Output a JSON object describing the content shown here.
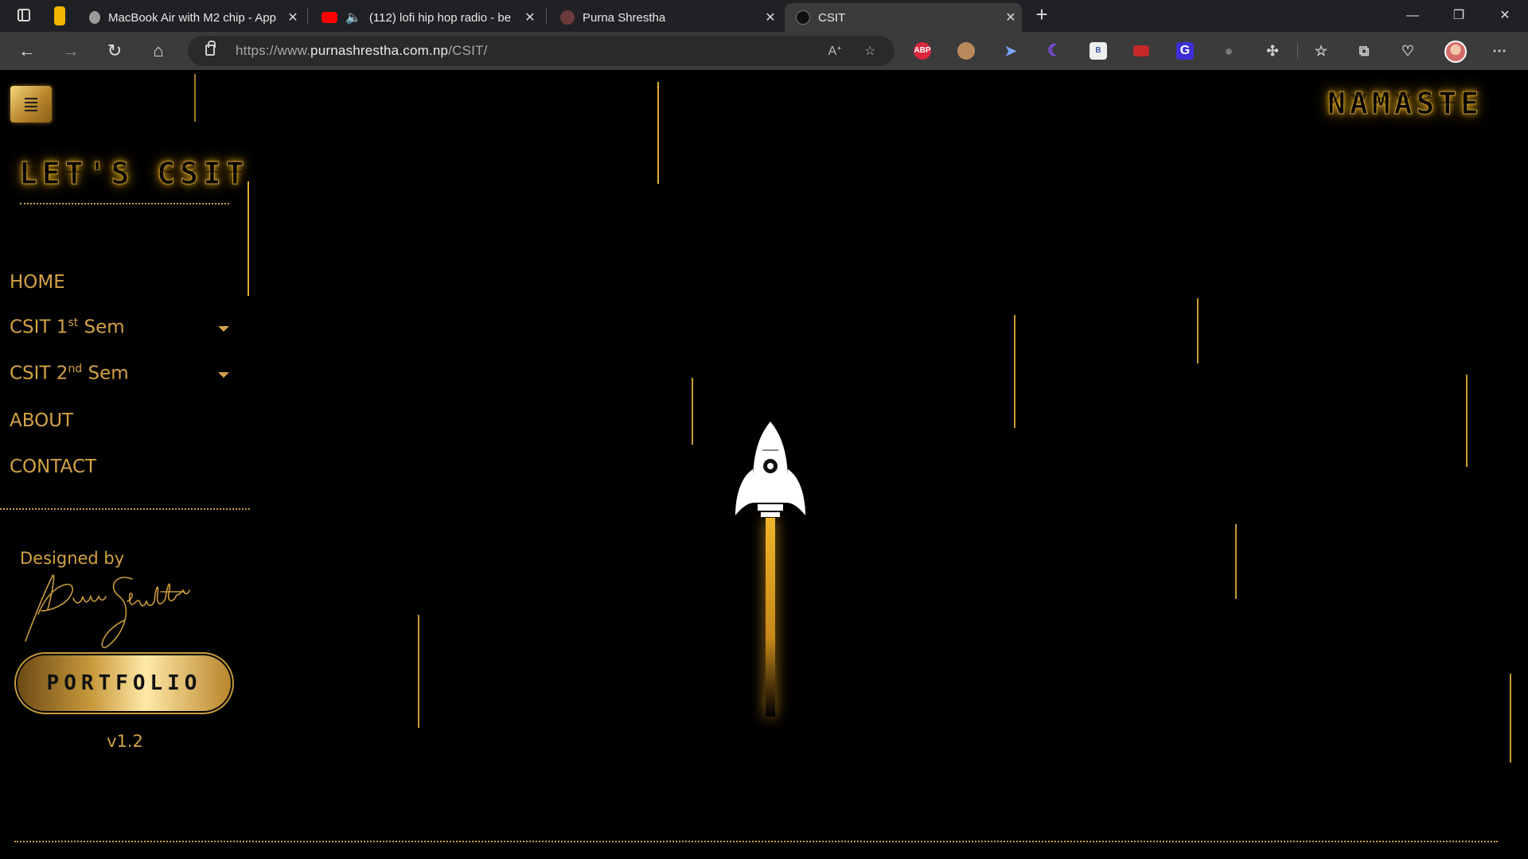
{
  "browser": {
    "tabs": [
      {
        "title": "MacBook Air with M2 chip - App",
        "favicon": "apple-icon"
      },
      {
        "title": "(112) lofi hip hop radio - be",
        "favicon": "youtube-icon",
        "audio": "speaker-icon"
      },
      {
        "title": "Purna Shrestha",
        "favicon": "person-icon"
      },
      {
        "title": "CSIT",
        "favicon": "site-icon",
        "active": true
      }
    ],
    "url_prefix": "https://www.",
    "url_domain": "purnashrestha.com.np",
    "url_path": "/CSIT/",
    "extensions": [
      "ABP",
      "B",
      "G"
    ],
    "colors": {
      "tabbar": "#202124",
      "toolbar": "#3b3b3b",
      "accent": "#f2b705"
    }
  },
  "site": {
    "brand": "LET'S CSIT",
    "greeting": "NAMASTE",
    "nav": [
      {
        "label": "HOME"
      },
      {
        "label": "CSIT 1",
        "sup": "st",
        "suffix": " Sem",
        "dropdown": true
      },
      {
        "label": "CSIT 2",
        "sup": "nd",
        "suffix": " Sem",
        "dropdown": true
      },
      {
        "label": "ABOUT"
      },
      {
        "label": "CONTACT"
      }
    ],
    "designed_by": "Designed by",
    "signature": "Purna Shrestha",
    "portfolio_label": "PORTFOLIO",
    "version": "v1.2",
    "colors": {
      "gold": "#d4a244",
      "background": "#000000"
    }
  }
}
